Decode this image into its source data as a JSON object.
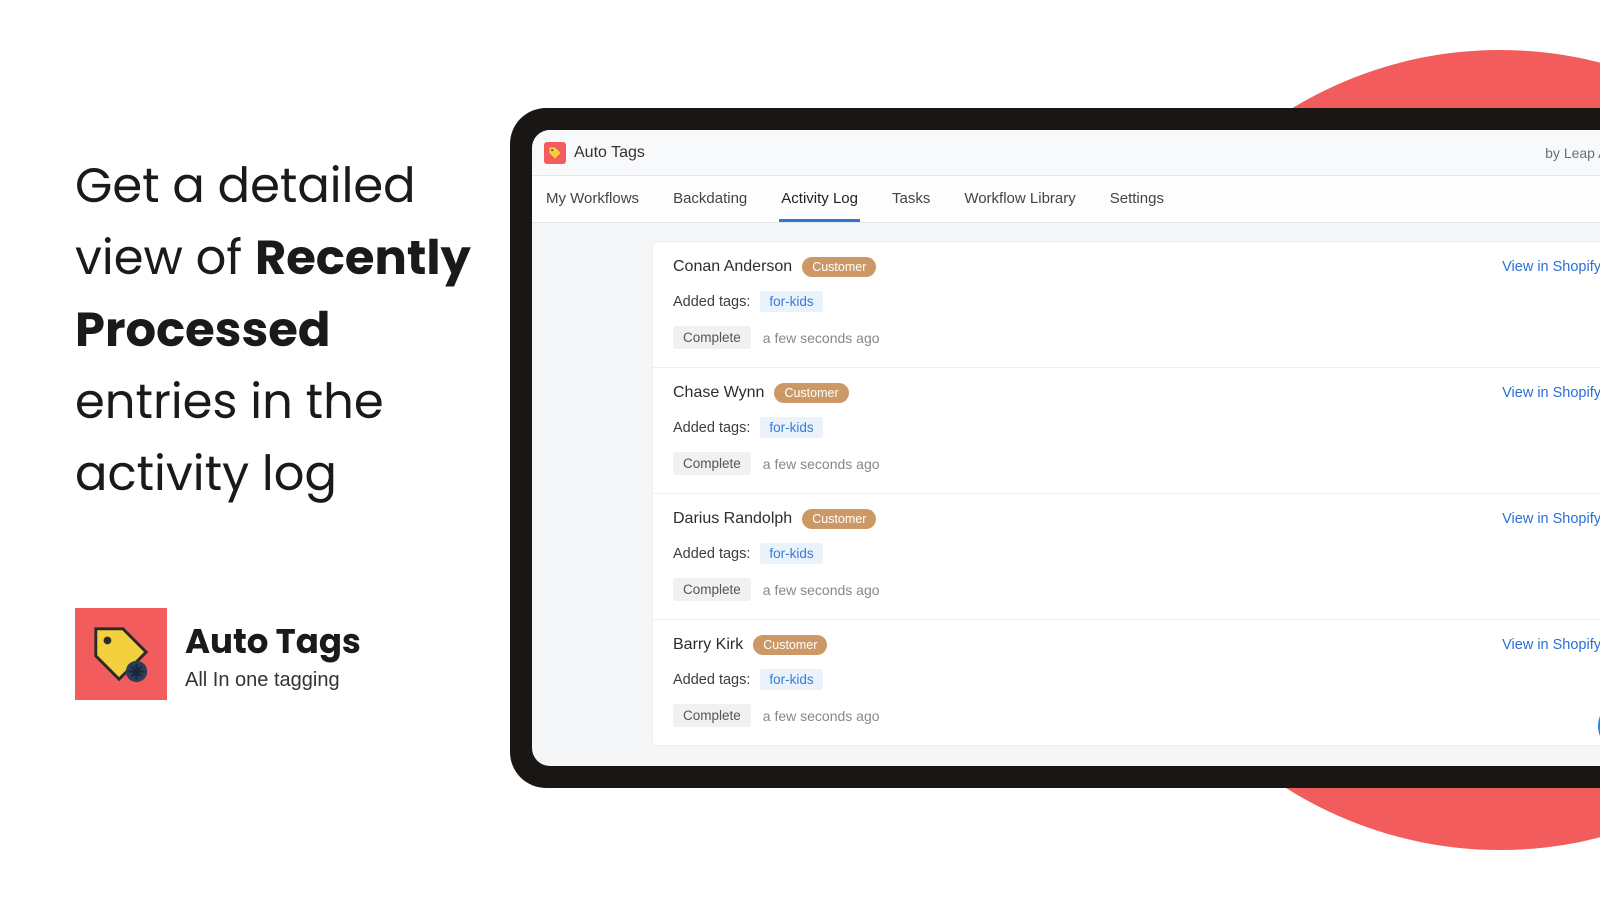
{
  "marketing": {
    "line1": "Get a detailed view of ",
    "bold": "Recently Processed",
    "line2": " entries in the activity log"
  },
  "product": {
    "name": "Auto Tags",
    "tagline": "All In one tagging"
  },
  "app": {
    "title": "Auto Tags",
    "byline": "by Leap Apps"
  },
  "tabs": [
    {
      "label": "My Workflows",
      "active": false
    },
    {
      "label": "Backdating",
      "active": false
    },
    {
      "label": "Activity Log",
      "active": true
    },
    {
      "label": "Tasks",
      "active": false
    },
    {
      "label": "Workflow Library",
      "active": false
    },
    {
      "label": "Settings",
      "active": false
    }
  ],
  "labels": {
    "added_tags": "Added tags:",
    "view_link": "View in Shopify",
    "status": "Complete",
    "type_badge": "Customer"
  },
  "entries": [
    {
      "name": "Conan Anderson",
      "tag": "for-kids",
      "time": "a few seconds ago"
    },
    {
      "name": "Chase Wynn",
      "tag": "for-kids",
      "time": "a few seconds ago"
    },
    {
      "name": "Darius Randolph",
      "tag": "for-kids",
      "time": "a few seconds ago"
    },
    {
      "name": "Barry Kirk",
      "tag": "for-kids",
      "time": "a few seconds ago"
    }
  ]
}
